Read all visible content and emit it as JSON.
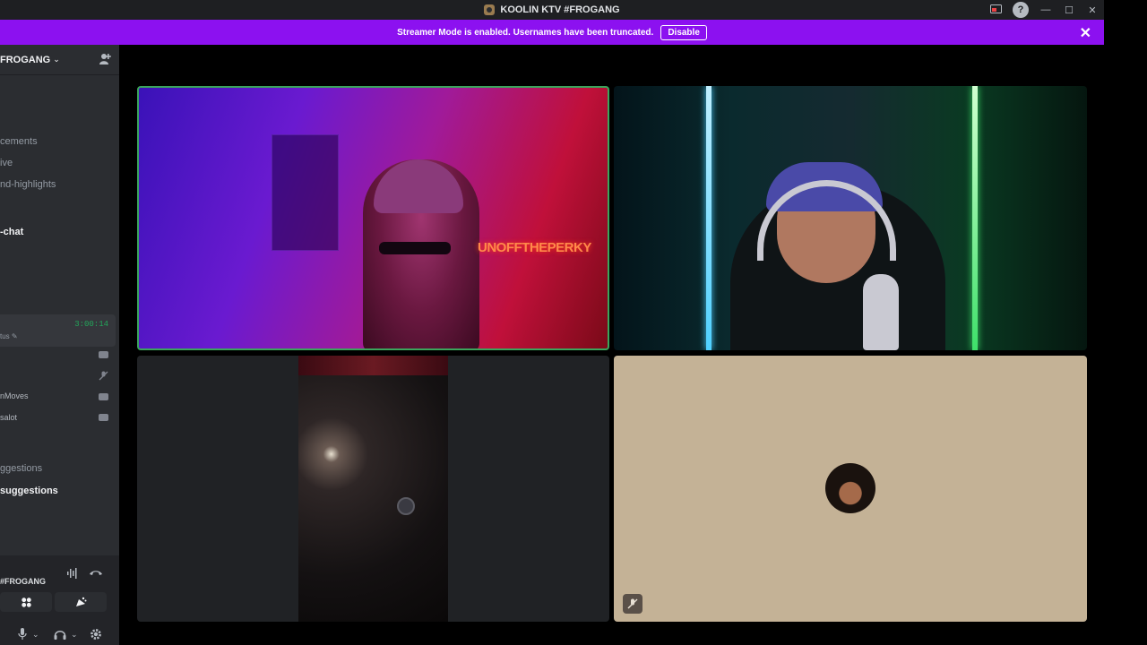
{
  "window": {
    "title": "KOOLIN KTV #FROGANG",
    "help_label": "?",
    "minimize_label": "—",
    "maximize_label": "☐",
    "close_label": "✕"
  },
  "banner": {
    "message": "Streamer Mode is enabled. Usernames have been truncated.",
    "disable_label": "Disable",
    "close_label": "✕",
    "color": "#8c11f0"
  },
  "sidebar": {
    "server_name": "FROGANG",
    "chevron": "⌄",
    "channels": [
      {
        "label": "cements"
      },
      {
        "label": "ive"
      },
      {
        "label": "nd-highlights"
      },
      {
        "label": "-chat"
      },
      {
        "label": "ggestions"
      },
      {
        "label": "suggestions"
      }
    ],
    "voice": {
      "timer": "3:00:14",
      "status": "tus ✎",
      "users": [
        {
          "name": "",
          "icon": "camera-icon"
        },
        {
          "name": "",
          "icon": "muted-mic-icon"
        },
        {
          "name": "nMoves",
          "icon": "camera-icon"
        },
        {
          "name": "salot",
          "icon": "camera-icon"
        }
      ]
    }
  },
  "panel": {
    "voice_channel": "#FROGANG",
    "mic_caret": "⌄",
    "headset_caret": "⌄"
  },
  "stage": {
    "tile1_overlay_text": "UNOFFTHEPERKY",
    "speaking_border_color": "#3ba55c"
  }
}
